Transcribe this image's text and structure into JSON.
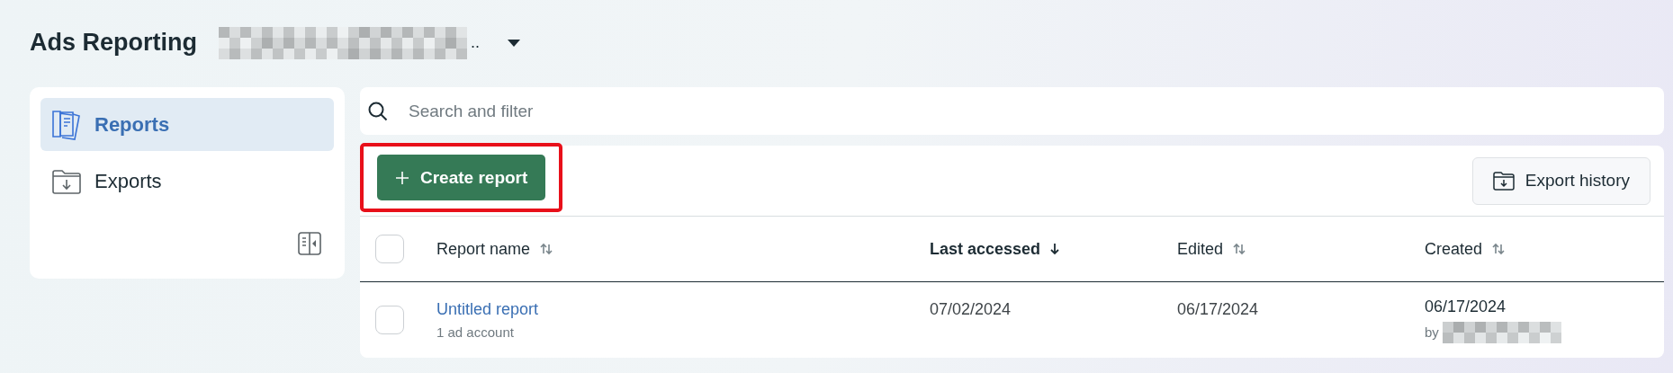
{
  "header": {
    "title": "Ads Reporting",
    "account_selector": {
      "text": ".."
    }
  },
  "sidebar": {
    "items": [
      {
        "label": "Reports",
        "kind": "reports",
        "selected": true
      },
      {
        "label": "Exports",
        "kind": "exports",
        "selected": false
      }
    ]
  },
  "search": {
    "placeholder": "Search and filter"
  },
  "toolbar": {
    "create_button": {
      "label": "Create report",
      "highlighted": true
    },
    "export_button": {
      "label": "Export history"
    }
  },
  "table": {
    "select_all": {
      "checked": false
    },
    "columns": [
      {
        "label": "Report name",
        "kind": "sortable",
        "bold": false
      },
      {
        "label": "Last accessed",
        "kind": "sorted-desc",
        "bold": true
      },
      {
        "label": "Edited",
        "kind": "sortable",
        "bold": false
      },
      {
        "label": "Created",
        "kind": "sortable",
        "bold": false
      }
    ],
    "rows": [
      {
        "checked": false,
        "name": "Untitled report",
        "subtitle": "1 ad account",
        "last_accessed": "07/02/2024",
        "edited": "06/17/2024",
        "created": "06/17/2024",
        "created_by": "by"
      }
    ]
  }
}
